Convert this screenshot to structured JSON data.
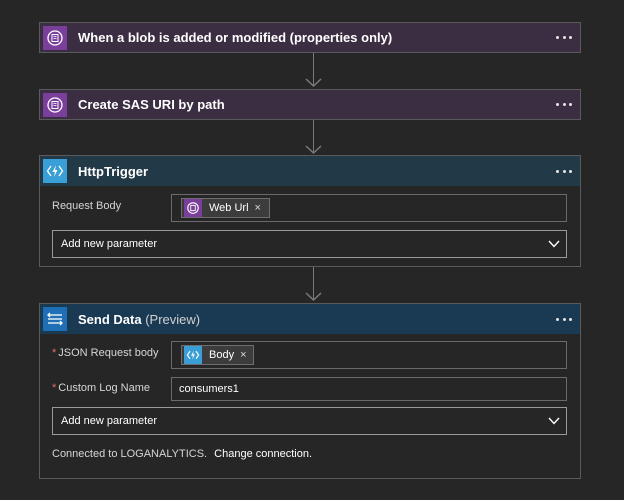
{
  "steps": [
    {
      "title": "When a blob is added or modified (properties only)",
      "icon": "blob-storage-icon",
      "color": "#7a3f9a"
    },
    {
      "title": "Create SAS URI by path",
      "icon": "blob-storage-icon",
      "color": "#7a3f9a"
    },
    {
      "title": "HttpTrigger",
      "icon": "azure-function-icon",
      "color": "#3a9fd6",
      "params": {
        "request_body_label": "Request Body",
        "request_body_token": "Web Url",
        "add_param_label": "Add new parameter"
      }
    },
    {
      "title": "Send Data",
      "title_suffix": "(Preview)",
      "icon": "log-analytics-icon",
      "color": "#1e6fb5",
      "params": {
        "required_mark": "*",
        "json_body_label": "JSON Request body",
        "json_body_token": "Body",
        "log_name_label": "Custom Log Name",
        "log_name_value": "consumers1",
        "add_param_label": "Add new parameter"
      },
      "connection_text": "Connected to LOGANALYTICS.",
      "change_connection": "Change connection."
    }
  ],
  "token_remove_glyph": "×"
}
